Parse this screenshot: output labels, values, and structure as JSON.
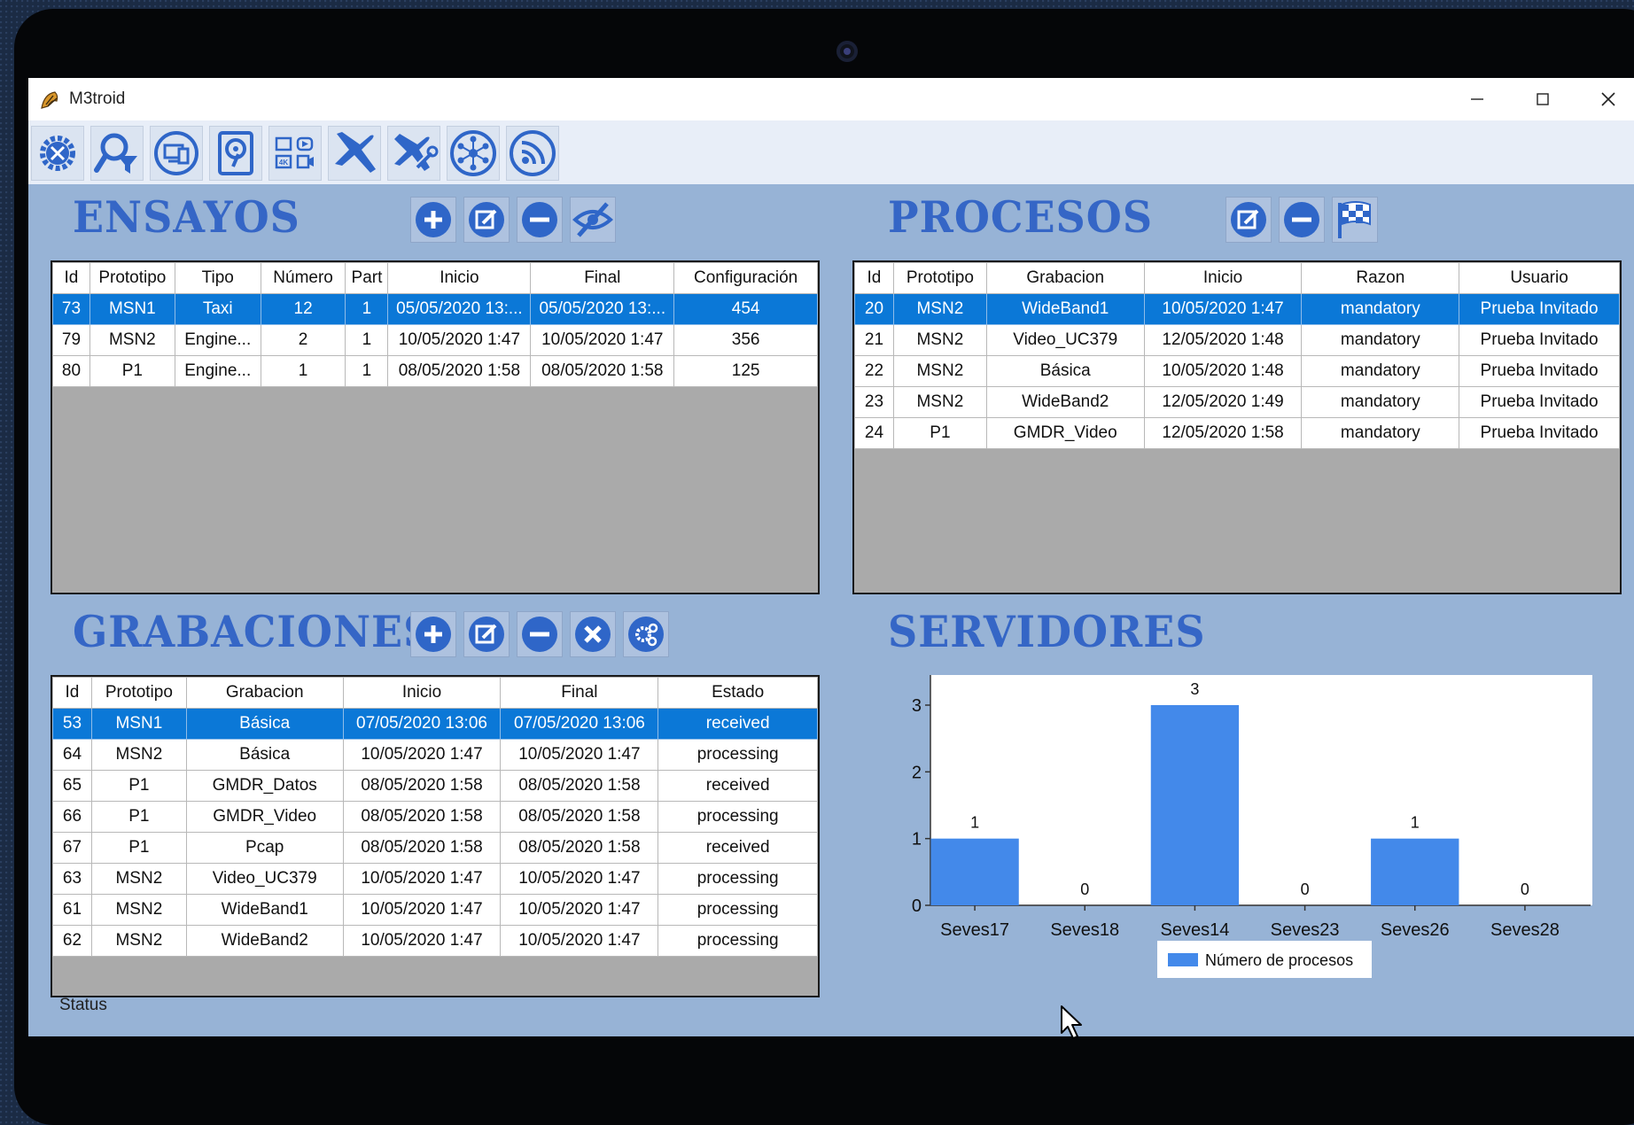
{
  "window": {
    "title": "M3troid"
  },
  "toolbar": {
    "buttons": [
      {
        "id": "settings",
        "icon": "gear-wrench-icon"
      },
      {
        "id": "search-filter",
        "icon": "search-filter-icon"
      },
      {
        "id": "devices",
        "icon": "devices-icon"
      },
      {
        "id": "hard-drive",
        "icon": "hard-drive-icon"
      },
      {
        "id": "media",
        "icon": "media-formats-icon"
      },
      {
        "id": "aircraft",
        "icon": "airplane-icon"
      },
      {
        "id": "maintenance",
        "icon": "airplane-wrench-icon"
      },
      {
        "id": "network",
        "icon": "network-icon"
      },
      {
        "id": "rss",
        "icon": "rss-icon"
      }
    ]
  },
  "ensayos": {
    "title": "ENSAYOS",
    "actions": [
      "add-icon",
      "edit-icon",
      "remove-icon",
      "hide-icon"
    ],
    "columns": [
      "Id",
      "Prototipo",
      "Tipo",
      "Número",
      "Part",
      "Inicio",
      "Final",
      "Configuración"
    ],
    "rows": [
      [
        "73",
        "MSN1",
        "Taxi",
        "12",
        "1",
        "05/05/2020 13:...",
        "05/05/2020 13:...",
        "454"
      ],
      [
        "79",
        "MSN2",
        "Engine...",
        "2",
        "1",
        "10/05/2020 1:47",
        "10/05/2020 1:47",
        "356"
      ],
      [
        "80",
        "P1",
        "Engine...",
        "1",
        "1",
        "08/05/2020 1:58",
        "08/05/2020 1:58",
        "125"
      ]
    ],
    "selected": 0
  },
  "procesos": {
    "title": "PROCESOS",
    "actions": [
      "edit-icon",
      "remove-icon",
      "finish-flag-icon"
    ],
    "columns": [
      "Id",
      "Prototipo",
      "Grabacion",
      "Inicio",
      "Razon",
      "Usuario"
    ],
    "rows": [
      [
        "20",
        "MSN2",
        "WideBand1",
        "10/05/2020 1:47",
        "mandatory",
        "Prueba Invitado"
      ],
      [
        "21",
        "MSN2",
        "Video_UC379",
        "12/05/2020 1:48",
        "mandatory",
        "Prueba Invitado"
      ],
      [
        "22",
        "MSN2",
        "Básica",
        "10/05/2020 1:48",
        "mandatory",
        "Prueba Invitado"
      ],
      [
        "23",
        "MSN2",
        "WideBand2",
        "12/05/2020 1:49",
        "mandatory",
        "Prueba Invitado"
      ],
      [
        "24",
        "P1",
        "GMDR_Video",
        "12/05/2020 1:58",
        "mandatory",
        "Prueba Invitado"
      ]
    ],
    "selected": 0
  },
  "grabaciones": {
    "title": "GRABACIONES",
    "actions": [
      "add-icon",
      "edit-icon",
      "remove-icon",
      "cancel-icon",
      "process-gear-icon"
    ],
    "columns": [
      "Id",
      "Prototipo",
      "Grabacion",
      "Inicio",
      "Final",
      "Estado"
    ],
    "rows": [
      [
        "53",
        "MSN1",
        "Básica",
        "07/05/2020 13:06",
        "07/05/2020 13:06",
        "received"
      ],
      [
        "64",
        "MSN2",
        "Básica",
        "10/05/2020 1:47",
        "10/05/2020 1:47",
        "processing"
      ],
      [
        "65",
        "P1",
        "GMDR_Datos",
        "08/05/2020 1:58",
        "08/05/2020 1:58",
        "received"
      ],
      [
        "66",
        "P1",
        "GMDR_Video",
        "08/05/2020 1:58",
        "08/05/2020 1:58",
        "processing"
      ],
      [
        "67",
        "P1",
        "Pcap",
        "08/05/2020 1:58",
        "08/05/2020 1:58",
        "received"
      ],
      [
        "63",
        "MSN2",
        "Video_UC379",
        "10/05/2020 1:47",
        "10/05/2020 1:47",
        "processing"
      ],
      [
        "61",
        "MSN2",
        "WideBand1",
        "10/05/2020 1:47",
        "10/05/2020 1:47",
        "processing"
      ],
      [
        "62",
        "MSN2",
        "WideBand2",
        "10/05/2020 1:47",
        "10/05/2020 1:47",
        "processing"
      ]
    ],
    "selected": 0
  },
  "servidores": {
    "title": "SERVIDORES"
  },
  "chart_data": {
    "type": "bar",
    "categories": [
      "Seves17",
      "Seves18",
      "Seves14",
      "Seves23",
      "Seves26",
      "Seves28"
    ],
    "series": [
      {
        "name": "Número de procesos",
        "values": [
          1,
          0,
          3,
          0,
          1,
          0
        ]
      }
    ],
    "ylim": [
      0,
      3
    ],
    "yticks": [
      0,
      1,
      2,
      3
    ],
    "data_labels": true,
    "legend": "bottom-center",
    "grid": false,
    "colors": {
      "bar": "#4389ea"
    }
  },
  "statusbar": {
    "text": "Status"
  },
  "colors": {
    "selection": "#0b78d7",
    "section_title": "#3566c6",
    "window_bg": "#97b3d6"
  }
}
